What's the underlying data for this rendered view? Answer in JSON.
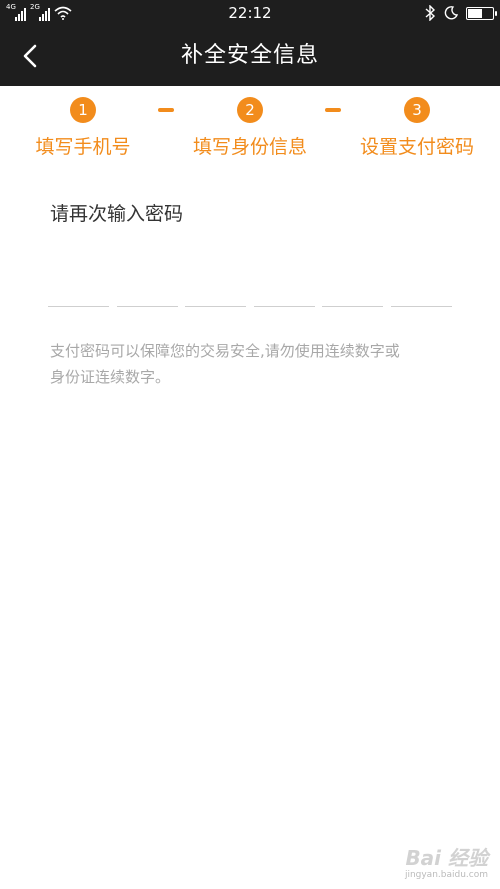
{
  "status_bar": {
    "network1": "4G",
    "network2": "2G",
    "time": "22:12"
  },
  "nav": {
    "title": "补全安全信息",
    "back_icon": "chevron-left-icon"
  },
  "steps": [
    {
      "number": "1",
      "label": "填写手机号"
    },
    {
      "number": "2",
      "label": "填写身份信息"
    },
    {
      "number": "3",
      "label": "设置支付密码"
    }
  ],
  "accent_color": "#f28c1c",
  "prompt": "请再次输入密码",
  "pin_slots": 6,
  "hint": {
    "line1": "支付密码可以保障您的交易安全,请勿使用连续数字或",
    "line2": "身份证连续数字。"
  },
  "watermark": {
    "brand": "Bai 经验",
    "url": "jingyan.baidu.com"
  }
}
